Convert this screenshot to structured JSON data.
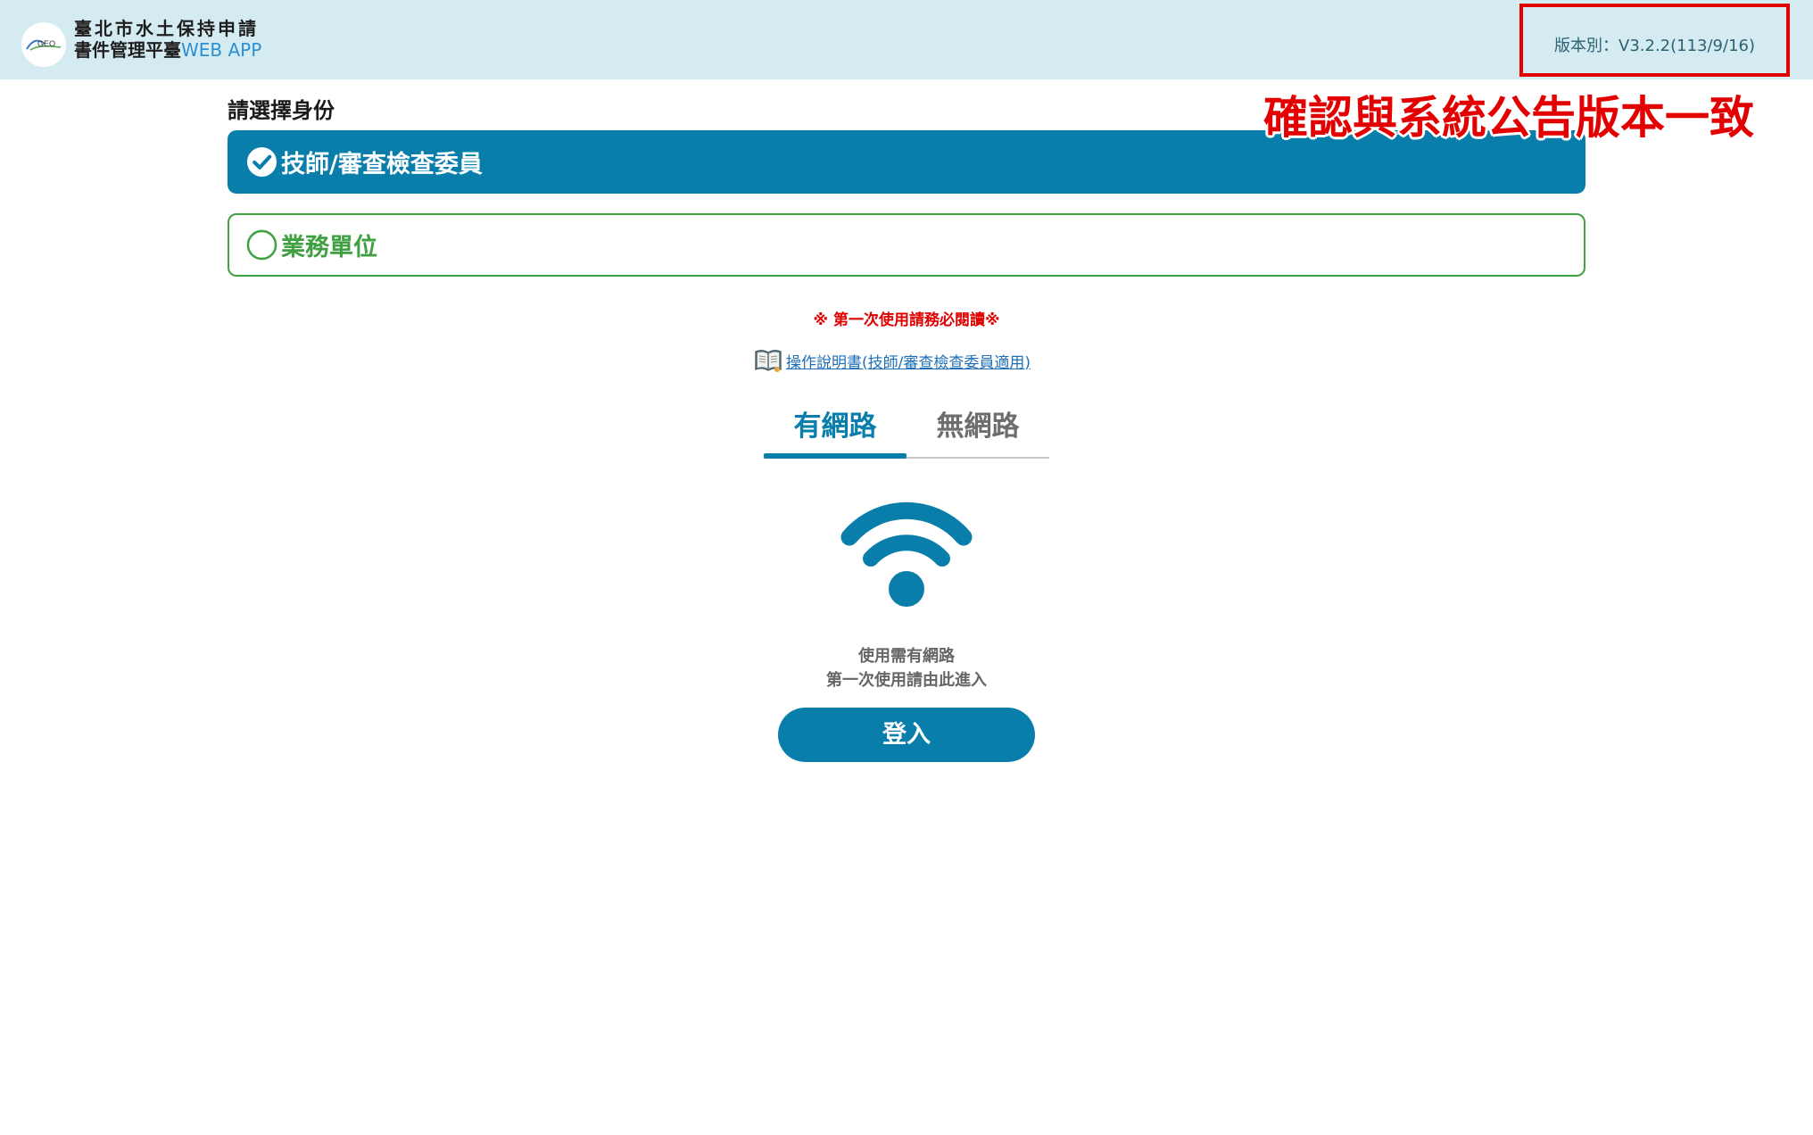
{
  "header": {
    "logo_text": "GEO",
    "title_line1": "臺北市水土保持申請",
    "title_line2_main": "書件管理平臺",
    "title_line2_suffix": "WEB APP",
    "version": "版本別：V3.2.2(113/9/16)"
  },
  "annotation": "確認與系統公告版本一致",
  "identity": {
    "label": "請選擇身份",
    "options": [
      {
        "label": "技師/審查檢查委員",
        "selected": true
      },
      {
        "label": "業務單位",
        "selected": false
      }
    ]
  },
  "notice": "※ 第一次使用請務必閱讀※",
  "manual_link": "操作說明書(技師/審查檢查委員適用)",
  "tabs": [
    {
      "label": "有網路",
      "active": true
    },
    {
      "label": "無網路",
      "active": false
    }
  ],
  "online": {
    "line1": "使用需有網路",
    "line2": "第一次使用請由此進入",
    "login_label": "登入"
  },
  "colors": {
    "header_bg": "#d4ebf2",
    "primary": "#0a7eab",
    "green": "#3fa142",
    "alert_red": "#e30000"
  },
  "icons": [
    "check-circle-icon",
    "empty-circle-icon",
    "book-icon",
    "wifi-icon"
  ]
}
